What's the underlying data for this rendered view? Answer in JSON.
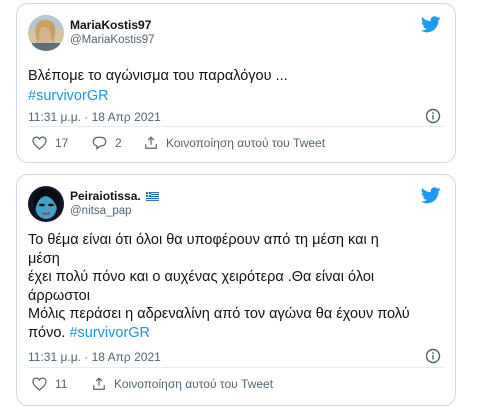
{
  "tweets": [
    {
      "name": "MariaKostis97",
      "handle": "@MariaKostis97",
      "lines": [
        "Βλέπομε το αγώνισμα του παραλόγου  ..."
      ],
      "hashtag": "#survivorGR",
      "timestamp": "11:31 μ.μ. · 18 Απρ 2021",
      "likes": "17",
      "replies": "2",
      "share_label": "Κοινοποίηση αυτού του Tweet",
      "avatar_icon": "profile-photo",
      "colors": {
        "avatar_bg": "#d9c7a6"
      }
    },
    {
      "name": "Peiraiotissa.",
      "handle": "@nitsa_pap",
      "lines": [
        "Το θέμα είναι ότι όλοι θα υποφέρουν από τη μέση και η",
        "μέση",
        "έχει πολύ πόνο και ο αυχένας χειρότερα .Θα είναι όλοι",
        "άρρωστοι",
        "Μόλις περάσει η αδρεναλίνη από τον αγώνα θα έχουν πολύ",
        "πόνο."
      ],
      "hashtag": "#survivorGR",
      "timestamp": "11:31 μ.μ. · 18 Απρ 2021",
      "likes": "11",
      "share_label": "Κοινοποίηση αυτού του Tweet",
      "avatar_icon": "profile-photo",
      "flag_icon": "greek-flag-icon",
      "colors": {
        "avatar_bg": "#1a1f3a"
      }
    }
  ],
  "colors": {
    "twitter_blue": "#1d9bf0",
    "hashtag": "#1b95e0",
    "muted": "#536471",
    "border": "#cfd9de"
  }
}
